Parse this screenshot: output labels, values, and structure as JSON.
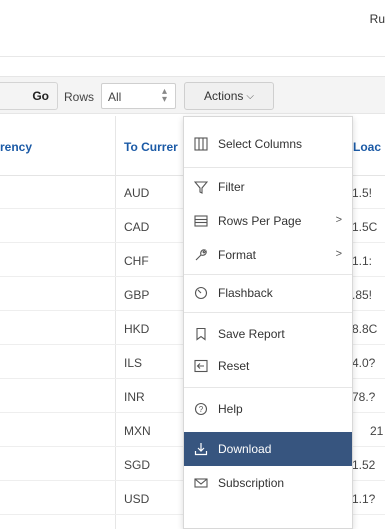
{
  "header": {
    "user_label": "Ru"
  },
  "toolbar": {
    "go_label": "Go",
    "rows_label": "Rows",
    "rows_value": "All",
    "actions_label": "Actions"
  },
  "table": {
    "columns": {
      "from": "rency",
      "to": "To Currer",
      "load": "Loac"
    },
    "rows": [
      {
        "to": "AUD",
        "load": "1.5!"
      },
      {
        "to": "CAD",
        "load": "1.5C"
      },
      {
        "to": "CHF",
        "load": "1.1:"
      },
      {
        "to": "GBP",
        "load": ".85!"
      },
      {
        "to": "HKD",
        "load": "8.8C"
      },
      {
        "to": "ILS",
        "load": "4.0?"
      },
      {
        "to": "INR",
        "load": "78.?"
      },
      {
        "to": "MXN",
        "load": "21"
      },
      {
        "to": "SGD",
        "load": "1.52"
      },
      {
        "to": "USD",
        "load": "1.1?"
      }
    ]
  },
  "actions_menu": {
    "items": [
      {
        "label": "Select Columns",
        "icon": "columns-icon"
      },
      {
        "label": "Filter",
        "icon": "filter-icon"
      },
      {
        "label": "Rows Per Page",
        "icon": "rows-per-page-icon",
        "submenu": true
      },
      {
        "label": "Format",
        "icon": "wrench-icon",
        "submenu": true
      },
      {
        "label": "Flashback",
        "icon": "clock-icon"
      },
      {
        "label": "Save Report",
        "icon": "bookmark-icon"
      },
      {
        "label": "Reset",
        "icon": "reset-icon"
      },
      {
        "label": "Help",
        "icon": "help-icon"
      },
      {
        "label": "Download",
        "icon": "download-icon",
        "active": true
      },
      {
        "label": "Subscription",
        "icon": "mail-icon"
      }
    ],
    "active_color": "#37557f"
  }
}
